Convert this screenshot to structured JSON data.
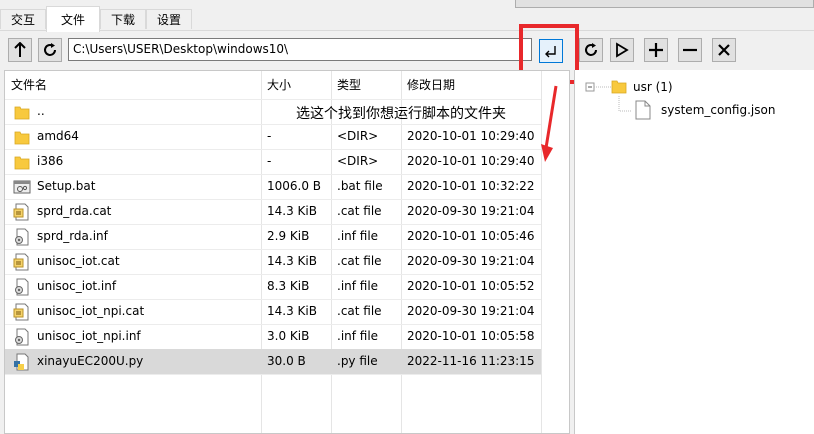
{
  "tabs": [
    "交互",
    "文件",
    "下载",
    "设置"
  ],
  "active_tab": "文件",
  "toolbar": {
    "up_icon": "up-arrow-icon",
    "refresh_icon": "refresh-icon",
    "path_value": "C:\\Users\\USER\\Desktop\\windows10\\",
    "enter_icon": "enter-return-icon",
    "remote_refresh_icon": "refresh-icon",
    "run_icon": "play-icon",
    "add_icon": "plus-icon",
    "remove_icon": "minus-icon",
    "close_icon": "close-icon"
  },
  "file_table": {
    "columns": [
      "文件名",
      "大小",
      "类型",
      "修改日期"
    ],
    "rows": [
      {
        "name": "..",
        "size": "",
        "type": "",
        "date": "",
        "icon": "folder-icon"
      },
      {
        "name": "amd64",
        "size": "-",
        "type": "<DIR>",
        "date": "2020-10-01 10:29:40",
        "icon": "folder-icon"
      },
      {
        "name": "i386",
        "size": "-",
        "type": "<DIR>",
        "date": "2020-10-01 10:29:40",
        "icon": "folder-icon"
      },
      {
        "name": "Setup.bat",
        "size": "1006.0 B",
        "type": ".bat file",
        "date": "2020-10-01 10:32:22",
        "icon": "batch-file-icon"
      },
      {
        "name": "sprd_rda.cat",
        "size": "14.3 KiB",
        "type": ".cat file",
        "date": "2020-09-30 19:21:04",
        "icon": "catalog-file-icon"
      },
      {
        "name": "sprd_rda.inf",
        "size": "2.9 KiB",
        "type": ".inf file",
        "date": "2020-10-01 10:05:46",
        "icon": "inf-file-icon"
      },
      {
        "name": "unisoc_iot.cat",
        "size": "14.3 KiB",
        "type": ".cat file",
        "date": "2020-09-30 19:21:04",
        "icon": "catalog-file-icon"
      },
      {
        "name": "unisoc_iot.inf",
        "size": "8.3 KiB",
        "type": ".inf file",
        "date": "2020-10-01 10:05:52",
        "icon": "inf-file-icon"
      },
      {
        "name": "unisoc_iot_npi.cat",
        "size": "14.3 KiB",
        "type": ".cat file",
        "date": "2020-09-30 19:21:04",
        "icon": "catalog-file-icon"
      },
      {
        "name": "unisoc_iot_npi.inf",
        "size": "3.0 KiB",
        "type": ".inf file",
        "date": "2020-10-01 10:05:58",
        "icon": "inf-file-icon"
      },
      {
        "name": "xinayuEC200U.py",
        "size": "30.0 B",
        "type": ".py file",
        "date": "2022-11-16 11:23:15",
        "icon": "python-file-icon",
        "selected": true
      }
    ]
  },
  "annotation": {
    "text": "选这个找到你想运行脚本的文件夹",
    "highlight_color": "#e8282b"
  },
  "remote_tree": {
    "root_label": "usr (1)",
    "children": [
      "system_config.json"
    ]
  },
  "colors": {
    "selection": "#d9d9d9",
    "folder": "#f8c93e",
    "accent": "#0078d7"
  }
}
